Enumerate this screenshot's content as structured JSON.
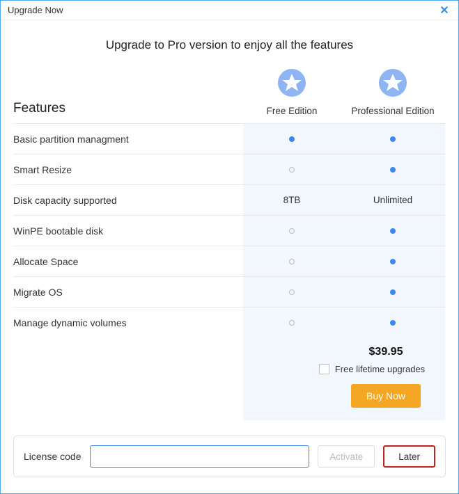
{
  "window": {
    "title": "Upgrade Now"
  },
  "headline": "Upgrade to Pro version to enjoy all the features",
  "features_title": "Features",
  "editions": {
    "free": {
      "name": "Free Edition"
    },
    "pro": {
      "name": "Professional Edition"
    }
  },
  "features": [
    {
      "label": "Basic partition managment",
      "free": "dot-blue",
      "pro": "dot-blue"
    },
    {
      "label": "Smart Resize",
      "free": "dot-hollow",
      "pro": "dot-blue"
    },
    {
      "label": "Disk capacity supported",
      "free": "8TB",
      "pro": "Unlimited"
    },
    {
      "label": "WinPE bootable disk",
      "free": "dot-hollow",
      "pro": "dot-blue"
    },
    {
      "label": "Allocate Space",
      "free": "dot-hollow",
      "pro": "dot-blue"
    },
    {
      "label": "Migrate OS",
      "free": "dot-hollow",
      "pro": "dot-blue"
    },
    {
      "label": "Manage dynamic volumes",
      "free": "dot-hollow",
      "pro": "dot-blue"
    }
  ],
  "pricing": {
    "price": "$39.95",
    "upgrades_label": "Free lifetime upgrades",
    "buy_button": "Buy Now"
  },
  "license": {
    "label": "License code",
    "value": "",
    "activate_label": "Activate",
    "later_label": "Later"
  }
}
